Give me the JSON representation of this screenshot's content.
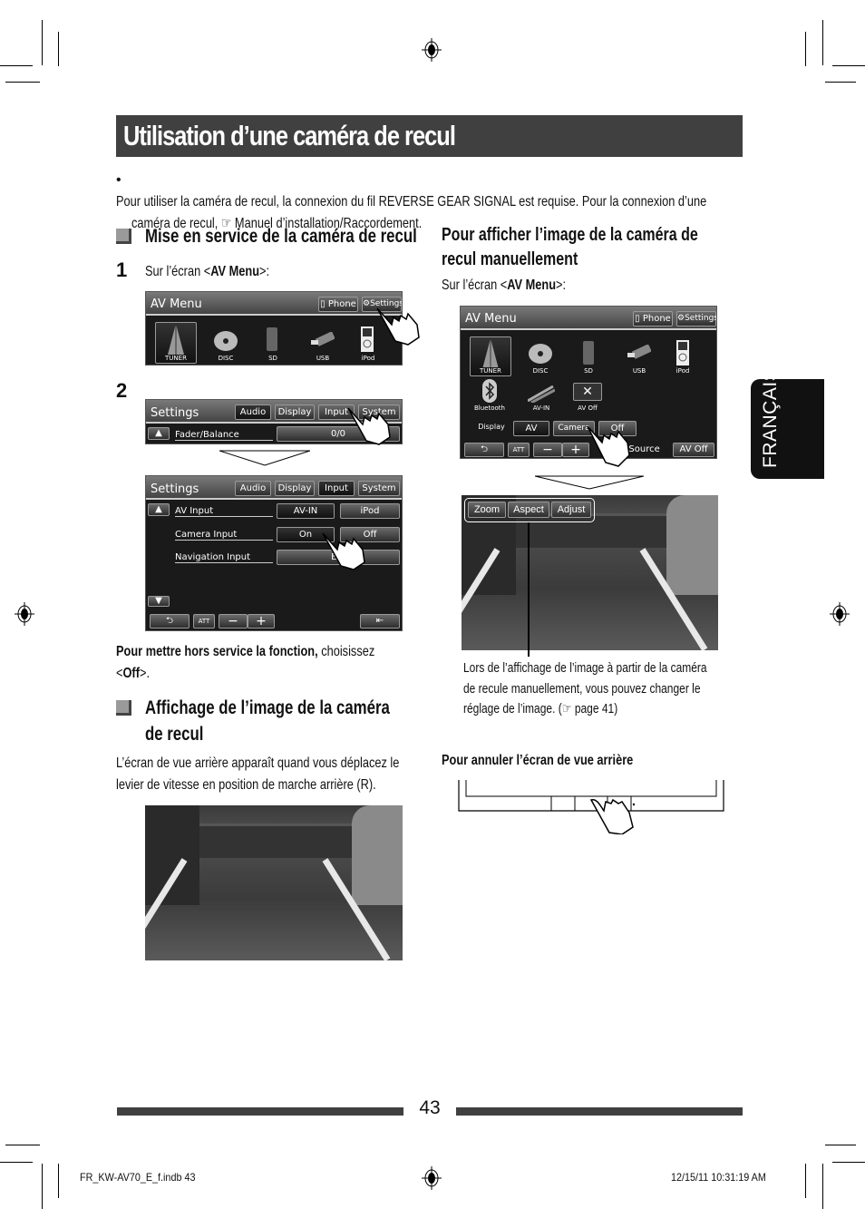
{
  "page": {
    "title": "Utilisation d’une caméra de recul",
    "intro_bullet": "Pour utiliser la caméra de recul, la connexion du fil REVERSE GEAR SIGNAL est requise. Pour la connexion d’une",
    "intro_bullet_line2": "caméra de recul, ☞ Manuel d’installation/Raccordement.",
    "side_tab": "FRANÇAIS",
    "page_number": "43",
    "footer_left": "FR_KW-AV70_E_f.indb   43",
    "footer_right": "12/15/11   10:31:19 AM"
  },
  "left": {
    "section1_heading": "Mise en service de la caméra de recul",
    "step1_num": "1",
    "step1_text_pre": "Sur l’écran <",
    "step1_text_bold": "AV Menu",
    "step1_text_post": ">:",
    "step2_num": "2",
    "off_note_bold": "Pour mettre hors service la fonction,",
    "off_note_rest": " choisissez",
    "off_note_line2_pre": "<",
    "off_note_line2_bold": "Off",
    "off_note_line2_post": ">.",
    "section2_heading_l1": "Affichage de l’image de la caméra",
    "section2_heading_l2": "de recul",
    "section2_body_l1": "L’écran de vue arrière apparaît quand vous déplacez le",
    "section2_body_l2": "levier de vitesse en position de marche arrière (R)."
  },
  "right": {
    "heading_l1": "Pour afficher l’image de la caméra de",
    "heading_l2": "recul manuellement",
    "step_text_pre": "Sur l’écran <",
    "step_text_bold": "AV Menu",
    "step_text_post": ">:",
    "caption_l1": "Lors de l’affichage de l’image à partir de la caméra",
    "caption_l2": "de recule manuellement, vous pouvez changer le",
    "caption_l3": "réglage de l’image. (☞  page 41)",
    "cancel_heading": "Pour annuler l’écran de vue arrière"
  },
  "av_menu_small": {
    "title": "AV Menu",
    "phone": "Phone",
    "settings": "Settings",
    "sources": [
      "TUNER",
      "DISC",
      "SD",
      "USB",
      "iPod"
    ]
  },
  "settings_screen1": {
    "title": "Settings",
    "tabs": [
      "Audio",
      "Display",
      "Input",
      "System"
    ],
    "row_label": "Fader/Balance",
    "row_value": "0/0"
  },
  "settings_screen2": {
    "title": "Settings",
    "tabs": [
      "Audio",
      "Display",
      "Input",
      "System"
    ],
    "rows": [
      {
        "label": "AV Input",
        "opt1": "AV-IN",
        "opt2": "iPod"
      },
      {
        "label": "Camera Input",
        "opt1": "On",
        "opt2": "Off"
      },
      {
        "label": "Navigation Input",
        "opt1": "E..."
      }
    ],
    "att": "ATT",
    "minus": "−",
    "plus": "+"
  },
  "av_menu_large": {
    "title": "AV Menu",
    "phone": "Phone",
    "settings": "Settings",
    "sources_row1": [
      "TUNER",
      "DISC",
      "SD",
      "USB",
      "iPod"
    ],
    "sources_row2": [
      "Bluetooth",
      "AV-IN",
      "AV Off"
    ],
    "display_label": "Display",
    "display_opts": [
      "AV",
      "Camera",
      "Off"
    ],
    "att": "ATT",
    "rear_source": "ar Source",
    "av_off": "AV Off"
  },
  "camera_view": {
    "buttons": [
      "Zoom",
      "Aspect",
      "Adjust"
    ]
  }
}
